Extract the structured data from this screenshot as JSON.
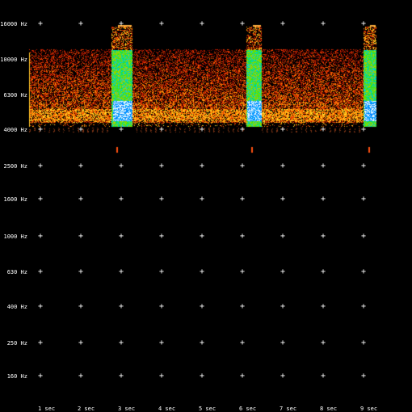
{
  "window": {
    "title": "",
    "background": "#000000",
    "text_color": "#ffffff"
  },
  "frequency_axis": {
    "labels": [
      "16000 Hz",
      "10000 Hz",
      "6300 Hz",
      "4000 Hz",
      "2500 Hz",
      "1600 Hz",
      "1000 Hz",
      "630 Hz",
      "400 Hz",
      "250 Hz",
      "160 Hz"
    ]
  },
  "time_axis": {
    "labels": [
      "1  sec",
      "2  sec",
      "3  sec",
      "4  sec",
      "5  sec",
      "6  sec",
      "7  sec",
      "8  sec",
      "9  sec"
    ]
  },
  "chart_data": {
    "type": "heatmap",
    "title": "",
    "xlabel": "",
    "ylabel": "",
    "x_unit": "sec",
    "y_unit": "Hz",
    "scale": "log",
    "grid": true,
    "y_ticks": [
      16000,
      10000,
      6300,
      4000,
      2500,
      1600,
      1000,
      630,
      400,
      250,
      160
    ],
    "x_ticks": [
      1,
      2,
      3,
      4,
      5,
      6,
      7,
      8,
      9
    ],
    "xlim": [
      0.0,
      9.3
    ],
    "ylim": [
      140,
      18000
    ],
    "noise_band": {
      "time": [
        0.0,
        9.3
      ],
      "freq": [
        4200,
        11500
      ]
    },
    "loud_events": [
      {
        "time": [
          2.75,
          3.25
        ],
        "freq": [
          4200,
          15500
        ]
      },
      {
        "time": [
          6.1,
          6.45
        ],
        "freq": [
          4200,
          15500
        ]
      },
      {
        "time": [
          9.0,
          9.3
        ],
        "freq": [
          4200,
          15500
        ]
      }
    ],
    "colors": {
      "low": "#800000",
      "mid": "#ff8000",
      "high": "#ffff00",
      "peak": "#0064ff",
      "max": "#ffffff"
    }
  }
}
